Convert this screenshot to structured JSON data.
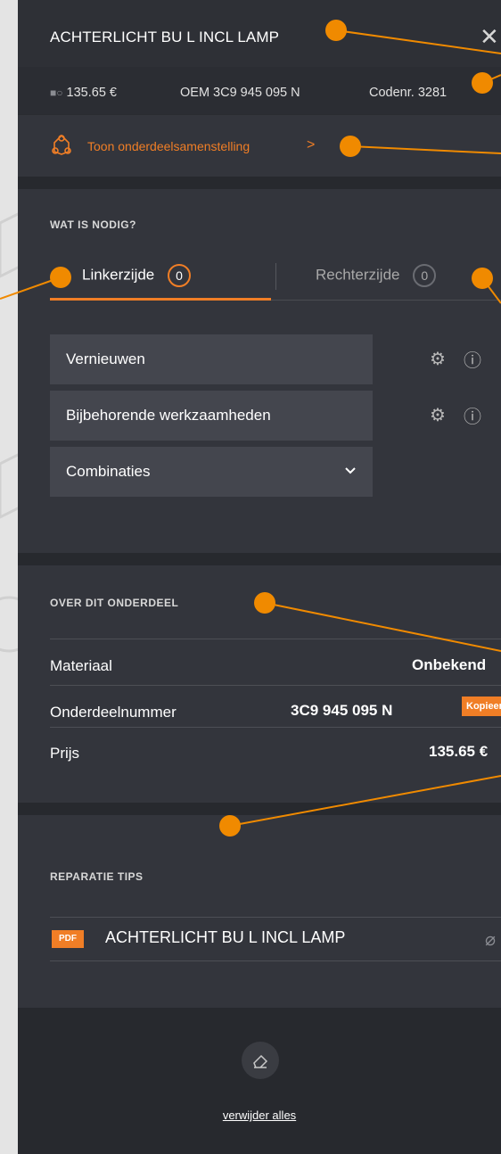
{
  "header": {
    "title": "ACHTERLICHT BU L INCL LAMP",
    "close_icon": "close-icon"
  },
  "meta": {
    "price": "135.65 €",
    "oem": "OEM 3C9 945 095 N",
    "code": "Codenr. 3281"
  },
  "assembly_link": {
    "label": "Toon onderdeelsamenstelling",
    "chevron": ">"
  },
  "needed": {
    "heading": "WAT IS NODIG?",
    "tabs": [
      {
        "label": "Linkerzijde",
        "count": "0"
      },
      {
        "label": "Rechterzijde",
        "count": "0"
      }
    ],
    "actions": [
      {
        "label": "Vernieuwen"
      },
      {
        "label": "Bijbehorende werkzaamheden"
      },
      {
        "label": "Combinaties"
      }
    ]
  },
  "about": {
    "heading": "OVER DIT ONDERDEEL",
    "rows": [
      {
        "label": "Materiaal",
        "value": "Onbekend"
      },
      {
        "label": "Onderdeelnummer",
        "value": "3C9 945 095 N"
      },
      {
        "label": "Prijs",
        "value": "135.65 €"
      }
    ],
    "copy_label": "Kopieer"
  },
  "tips": {
    "heading": "REPARATIE TIPS",
    "items": [
      {
        "badge": "PDF",
        "name": "ACHTERLICHT BU L INCL LAMP"
      }
    ]
  },
  "footer": {
    "clear_label": "verwijder alles"
  },
  "colors": {
    "accent": "#f07e26",
    "panel": "#33353c",
    "annotation": "#f08a00"
  }
}
